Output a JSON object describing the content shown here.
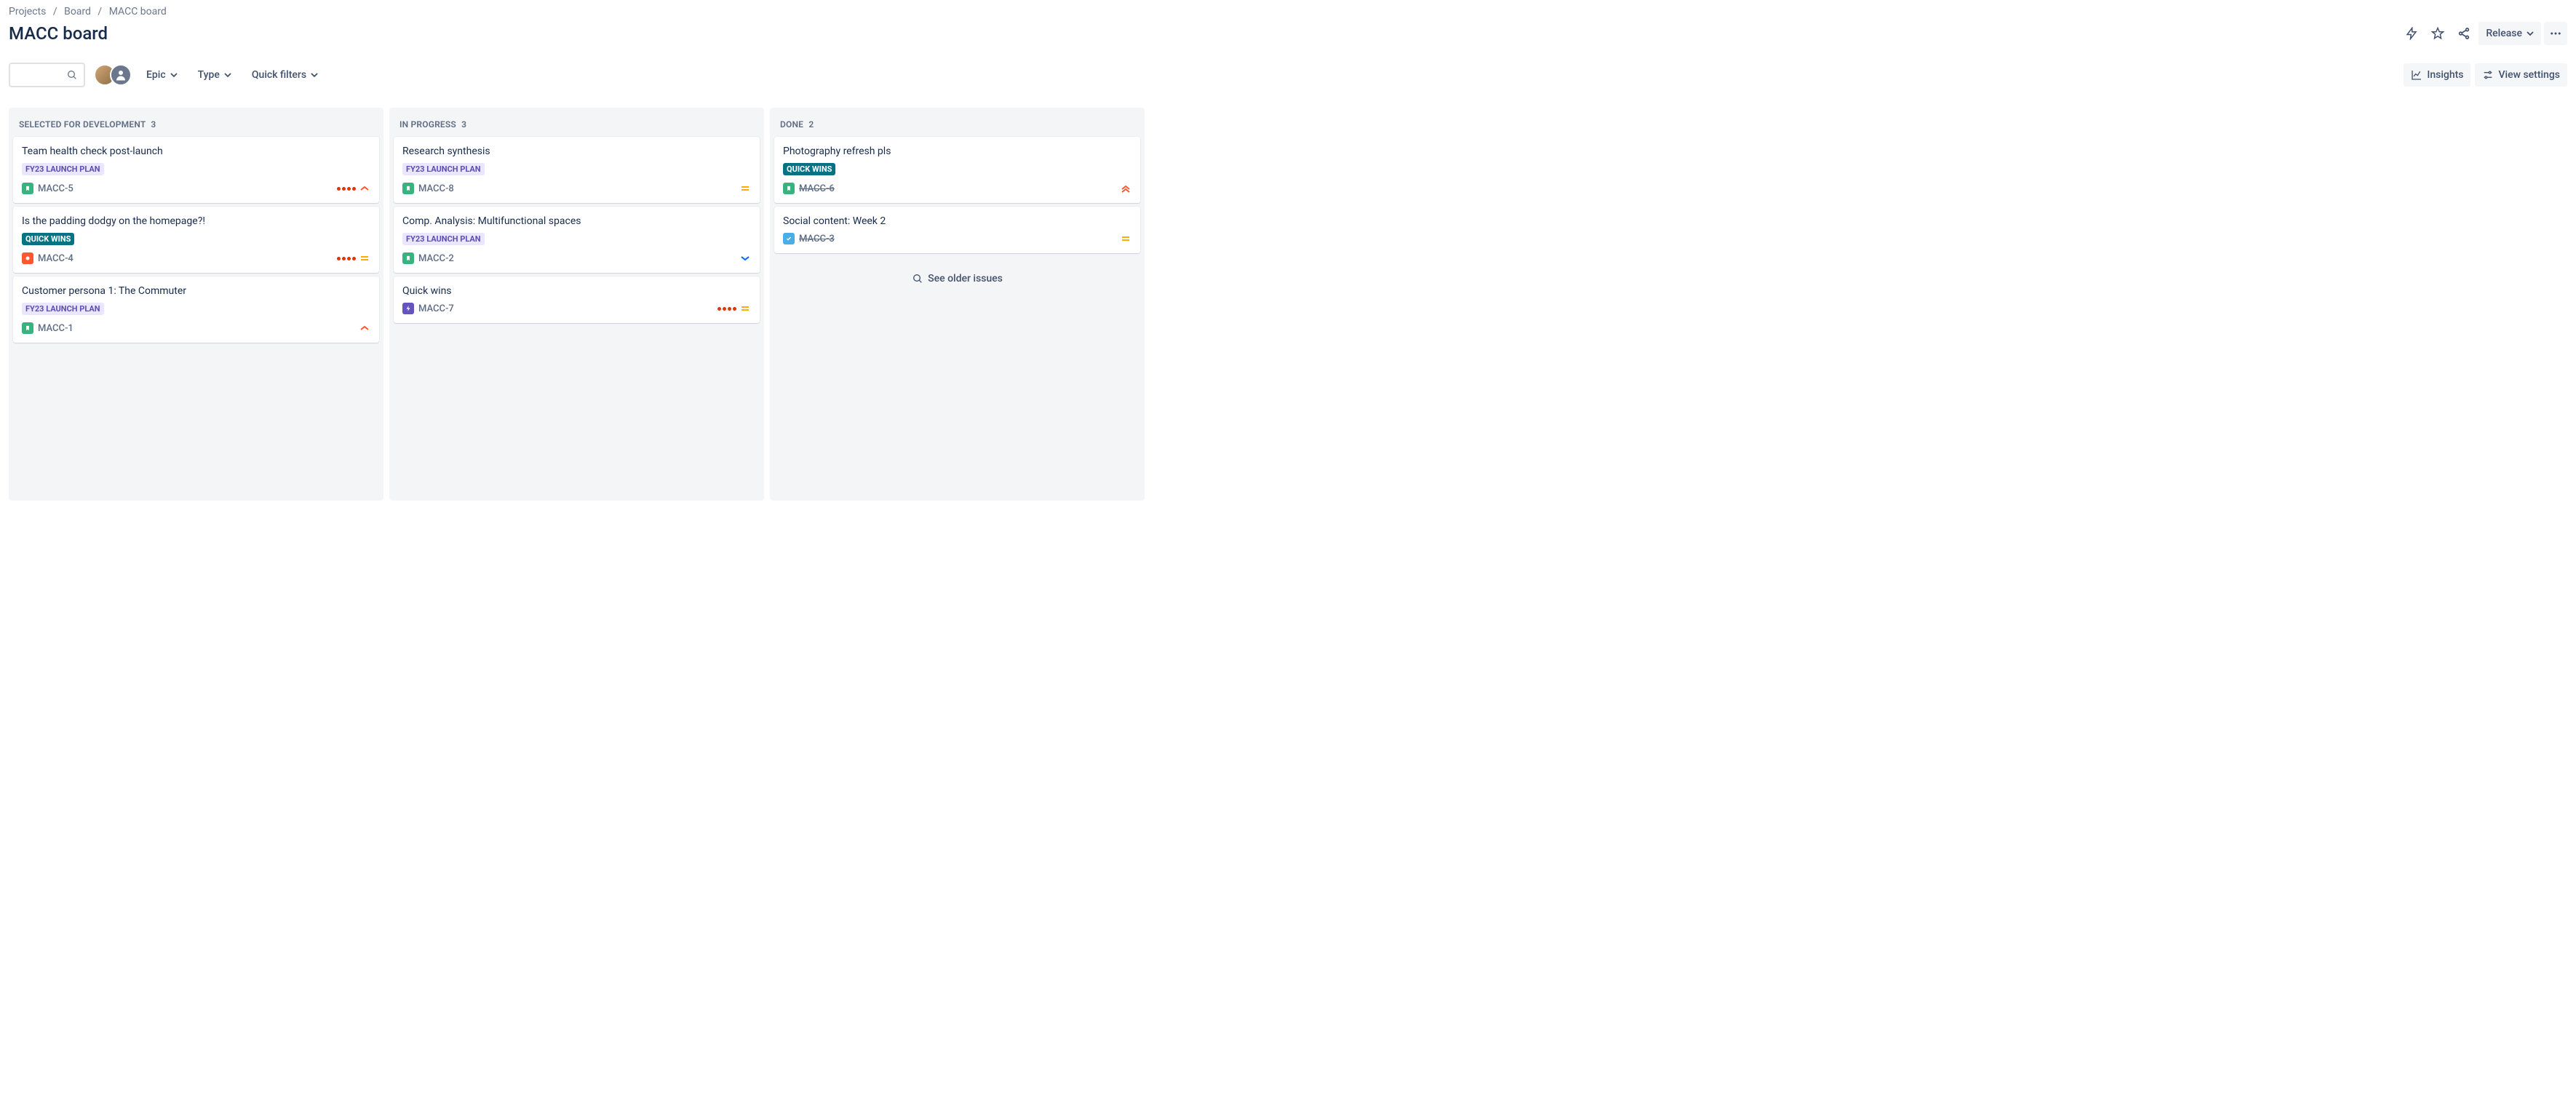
{
  "breadcrumbs": {
    "projects": "Projects",
    "board": "Board",
    "current": "MACC board"
  },
  "page_title": "MACC board",
  "header": {
    "release": "Release",
    "insights": "Insights",
    "view_settings": "View settings"
  },
  "filters": {
    "epic": "Epic",
    "type": "Type",
    "quick": "Quick filters"
  },
  "columns": [
    {
      "name": "Selected for Development",
      "count": "3",
      "cards": [
        {
          "title": "Team health check post-launch",
          "badge": "FY23 LAUNCH PLAN",
          "badge_style": "launch",
          "type": "story",
          "key": "MACC-5",
          "dots": 4,
          "priority": "high",
          "done": false
        },
        {
          "title": "Is the padding dodgy on the homepage?!",
          "badge": "QUICK WINS",
          "badge_style": "quickwins",
          "type": "bug",
          "key": "MACC-4",
          "dots": 4,
          "priority": "medium",
          "done": false
        },
        {
          "title": "Customer persona 1: The Commuter",
          "badge": "FY23 LAUNCH PLAN",
          "badge_style": "launch",
          "type": "story",
          "key": "MACC-1",
          "dots": 0,
          "priority": "high",
          "done": false
        }
      ]
    },
    {
      "name": "In Progress",
      "count": "3",
      "cards": [
        {
          "title": "Research synthesis",
          "badge": "FY23 LAUNCH PLAN",
          "badge_style": "launch",
          "type": "story",
          "key": "MACC-8",
          "dots": 0,
          "priority": "medium",
          "done": false
        },
        {
          "title": "Comp. Analysis: Multifunctional spaces",
          "badge": "FY23 LAUNCH PLAN",
          "badge_style": "launch",
          "type": "story",
          "key": "MACC-2",
          "dots": 0,
          "priority": "low",
          "done": false
        },
        {
          "title": "Quick wins",
          "badge": "",
          "badge_style": "",
          "type": "epic",
          "key": "MACC-7",
          "dots": 4,
          "priority": "medium",
          "done": false
        }
      ]
    },
    {
      "name": "Done",
      "count": "2",
      "cards": [
        {
          "title": "Photography refresh pls",
          "badge": "QUICK WINS",
          "badge_style": "quickwins",
          "type": "story",
          "key": "MACC-6",
          "dots": 0,
          "priority": "highest",
          "done": true
        },
        {
          "title": "Social content: Week 2",
          "badge": "",
          "badge_style": "",
          "type": "task",
          "key": "MACC-3",
          "dots": 0,
          "priority": "medium",
          "done": true
        }
      ],
      "older": "See older issues"
    }
  ]
}
